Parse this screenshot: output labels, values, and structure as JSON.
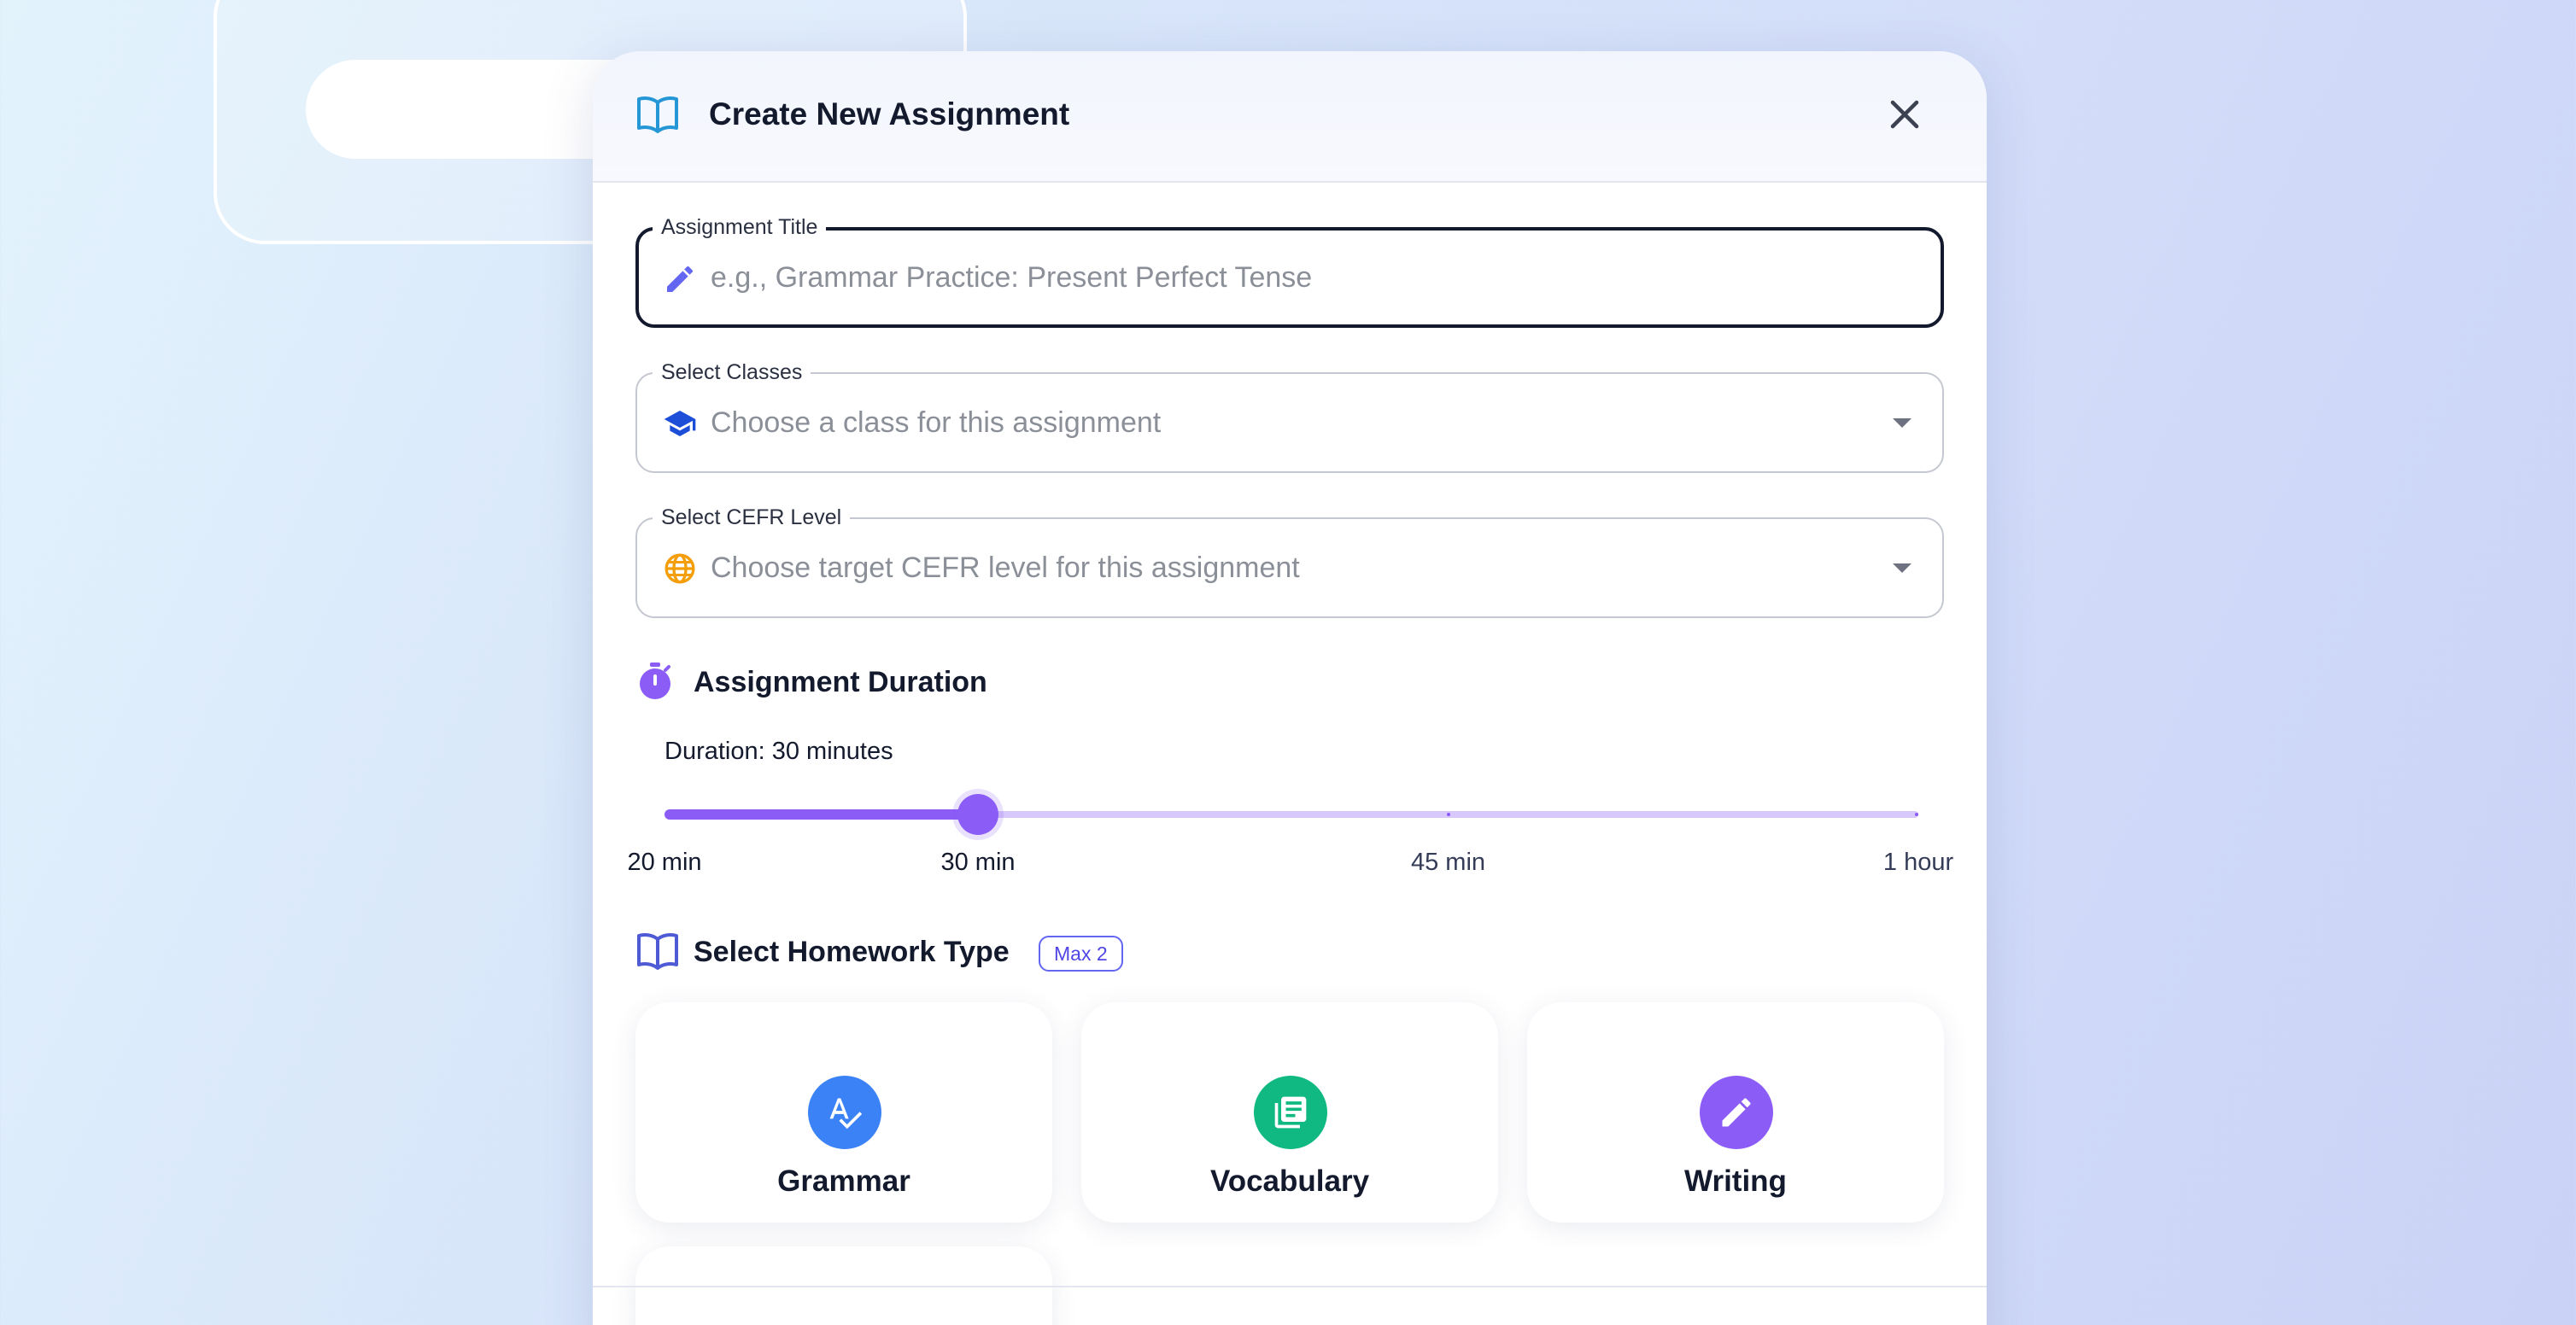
{
  "dialog": {
    "title": "Create New Assignment",
    "close_icon": "close-icon"
  },
  "form": {
    "assignment_title": {
      "label": "Assignment Title",
      "value": "",
      "placeholder": "e.g., Grammar Practice: Present Perfect Tense",
      "icon": "pencil-icon",
      "icon_color": "#6366f1"
    },
    "classes": {
      "label": "Select Classes",
      "placeholder": "Choose a class for this assignment",
      "icon": "graduation-cap-icon",
      "icon_color": "#1d4ed8"
    },
    "cefr_level": {
      "label": "Select CEFR Level",
      "placeholder": "Choose target CEFR level for this assignment",
      "icon": "globe-icon",
      "icon_color": "#f59e0b"
    }
  },
  "duration": {
    "section_title": "Assignment Duration",
    "icon": "stopwatch-icon",
    "value_text": "Duration: 30 minutes",
    "value_minutes": 30,
    "min_minutes": 20,
    "max_minutes": 60,
    "marks": [
      {
        "minutes": 20,
        "label": "20 min"
      },
      {
        "minutes": 30,
        "label": "30 min"
      },
      {
        "minutes": 45,
        "label": "45 min"
      },
      {
        "minutes": 60,
        "label": "1 hour"
      }
    ],
    "accent_color": "#8b5cf6"
  },
  "homework": {
    "section_title": "Select Homework Type",
    "icon": "book-open-icon",
    "badge": "Max 2",
    "types": [
      {
        "label": "Grammar",
        "icon": "spellcheck-icon",
        "color": "#3b82f6"
      },
      {
        "label": "Vocabulary",
        "icon": "library-books-icon",
        "color": "#10b981"
      },
      {
        "label": "Writing",
        "icon": "pencil-icon",
        "color": "#8b5cf6"
      }
    ]
  }
}
